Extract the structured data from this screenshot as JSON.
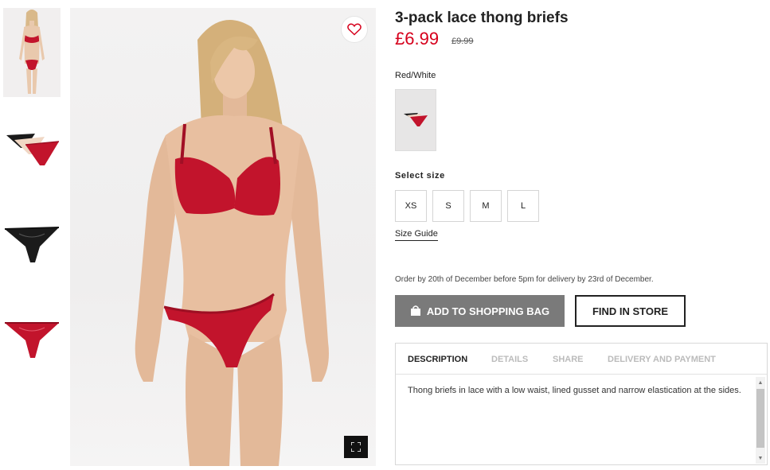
{
  "product": {
    "title": "3-pack lace thong briefs",
    "price": "£6.99",
    "old_price": "£9.99",
    "color_name": "Red/White"
  },
  "sizes": {
    "label": "Select size",
    "options": [
      "XS",
      "S",
      "M",
      "L"
    ],
    "guide_label": "Size Guide"
  },
  "delivery": {
    "note": "Order by 20th of December before 5pm for delivery by 23rd of December."
  },
  "actions": {
    "add_to_bag": "ADD TO SHOPPING BAG",
    "find_in_store": "FIND IN STORE"
  },
  "tabs": {
    "items": [
      "DESCRIPTION",
      "DETAILS",
      "SHARE",
      "DELIVERY AND PAYMENT"
    ],
    "description": "Thong briefs in lace with a low waist, lined gusset and narrow elastication at the sides."
  },
  "colors": {
    "price_red": "#d6001c",
    "product_red": "#c2142c",
    "button_grey": "#7a7a7a"
  },
  "icons": [
    "heart-icon",
    "expand-icon",
    "shopping-bag-icon",
    "scroll-up-icon",
    "scroll-down-icon"
  ]
}
